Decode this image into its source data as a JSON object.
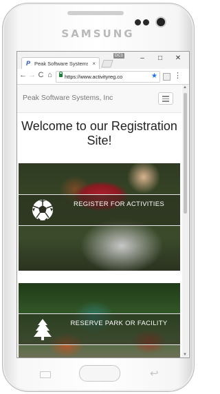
{
  "device": {
    "brand": "SAMSUNG"
  },
  "browser": {
    "tab_title": "Peak Software Systems, Inc",
    "tab_close": "×",
    "window_label": "DC1",
    "window_controls": {
      "minimize": "–",
      "maximize": "□",
      "close": "✕"
    },
    "nav": {
      "back": "←",
      "forward": "→",
      "reload": "C",
      "home": "⌂"
    },
    "url": "https://www.activityreg.co",
    "star": "★",
    "menu": "⋮"
  },
  "page": {
    "brand": "Peak Software Systems, Inc",
    "heading": "Welcome to our Registration Site!",
    "cta1": {
      "label": "REGISTER FOR ACTIVITIES",
      "icon": "soccer-ball-icon"
    },
    "cta2": {
      "label": "RESERVE PARK OR FACILITY",
      "icon": "pine-tree-icon"
    }
  }
}
